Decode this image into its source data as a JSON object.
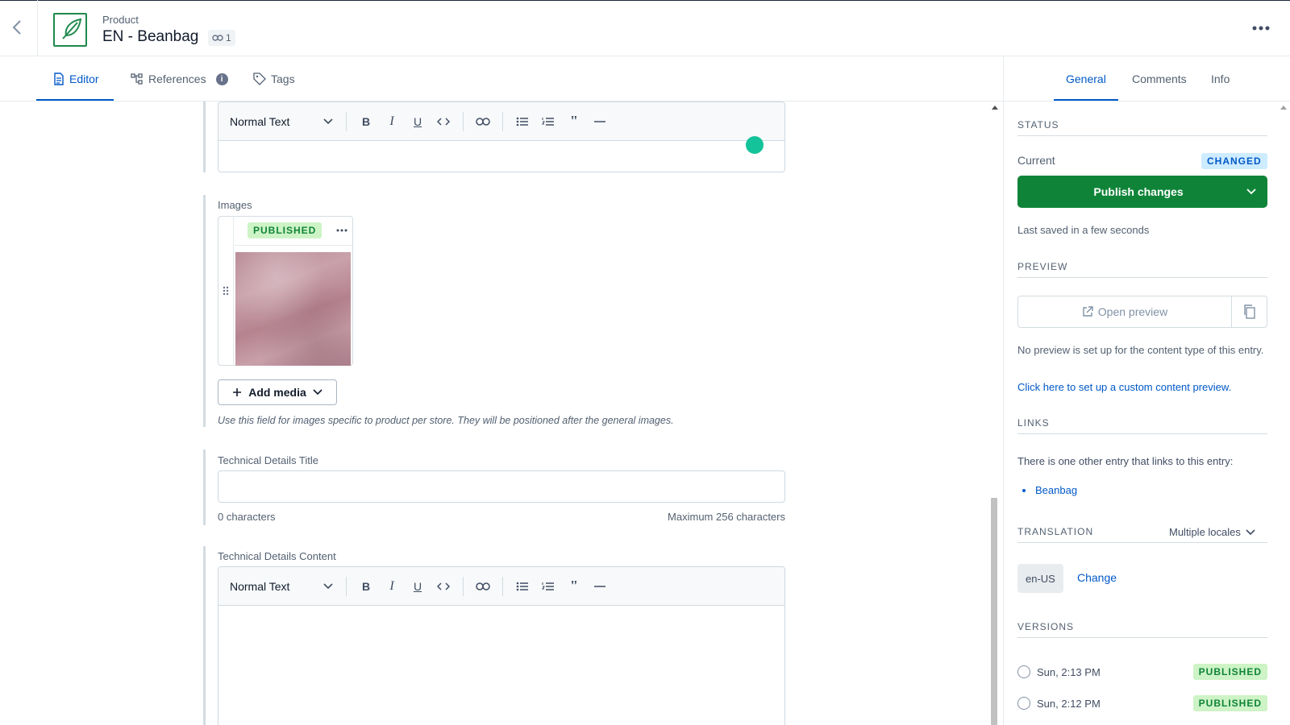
{
  "header": {
    "content_type": "Product",
    "entry_title": "EN - Beanbag",
    "ref_count": "1"
  },
  "tabs": [
    {
      "label": "Editor"
    },
    {
      "label": "References"
    },
    {
      "label": "Tags"
    }
  ],
  "toolbar": {
    "text_style": "Normal Text"
  },
  "fields": {
    "images_label": "Images",
    "image_status": "PUBLISHED",
    "add_media_label": "Add media",
    "images_help": "Use this field for images specific to product per store. They will be positioned after the general images.",
    "tech_title_label": "Technical Details Title",
    "tech_title_value": "",
    "tech_title_count": "0 characters",
    "tech_title_max": "Maximum 256 characters",
    "tech_content_label": "Technical Details Content"
  },
  "sidebar": {
    "tabs": [
      {
        "label": "General"
      },
      {
        "label": "Comments"
      },
      {
        "label": "Info"
      }
    ],
    "status": {
      "title": "STATUS",
      "current_label": "Current",
      "badge": "CHANGED",
      "publish_label": "Publish changes",
      "last_saved": "Last saved in a few seconds"
    },
    "preview": {
      "title": "PREVIEW",
      "open_label": "Open preview",
      "note": "No preview is set up for the content type of this entry.",
      "link": "Click here to set up a custom content preview."
    },
    "links": {
      "title": "LINKS",
      "note": "There is one other entry that links to this entry:",
      "items": [
        "Beanbag"
      ]
    },
    "translation": {
      "title": "TRANSLATION",
      "mode": "Multiple locales",
      "locale": "en-US",
      "change_label": "Change"
    },
    "versions": {
      "title": "VERSIONS",
      "items": [
        {
          "time": "Sun, 2:13 PM",
          "status": "PUBLISHED"
        },
        {
          "time": "Sun, 2:12 PM",
          "status": "PUBLISHED"
        }
      ]
    }
  },
  "colors": {
    "accent": "#0059c8",
    "publish_green": "#0f8438",
    "published_badge_bg": "#cdf3c6",
    "changed_badge_bg": "#ceecff"
  },
  "icons": [
    "chevron-left-icon",
    "feather-icon",
    "link-icon",
    "more-horizontal-icon",
    "document-icon",
    "references-icon",
    "info-icon",
    "tag-icon",
    "external-link-icon",
    "copy-icon",
    "chevron-down-icon",
    "drag-handle-icon",
    "plus-icon"
  ]
}
